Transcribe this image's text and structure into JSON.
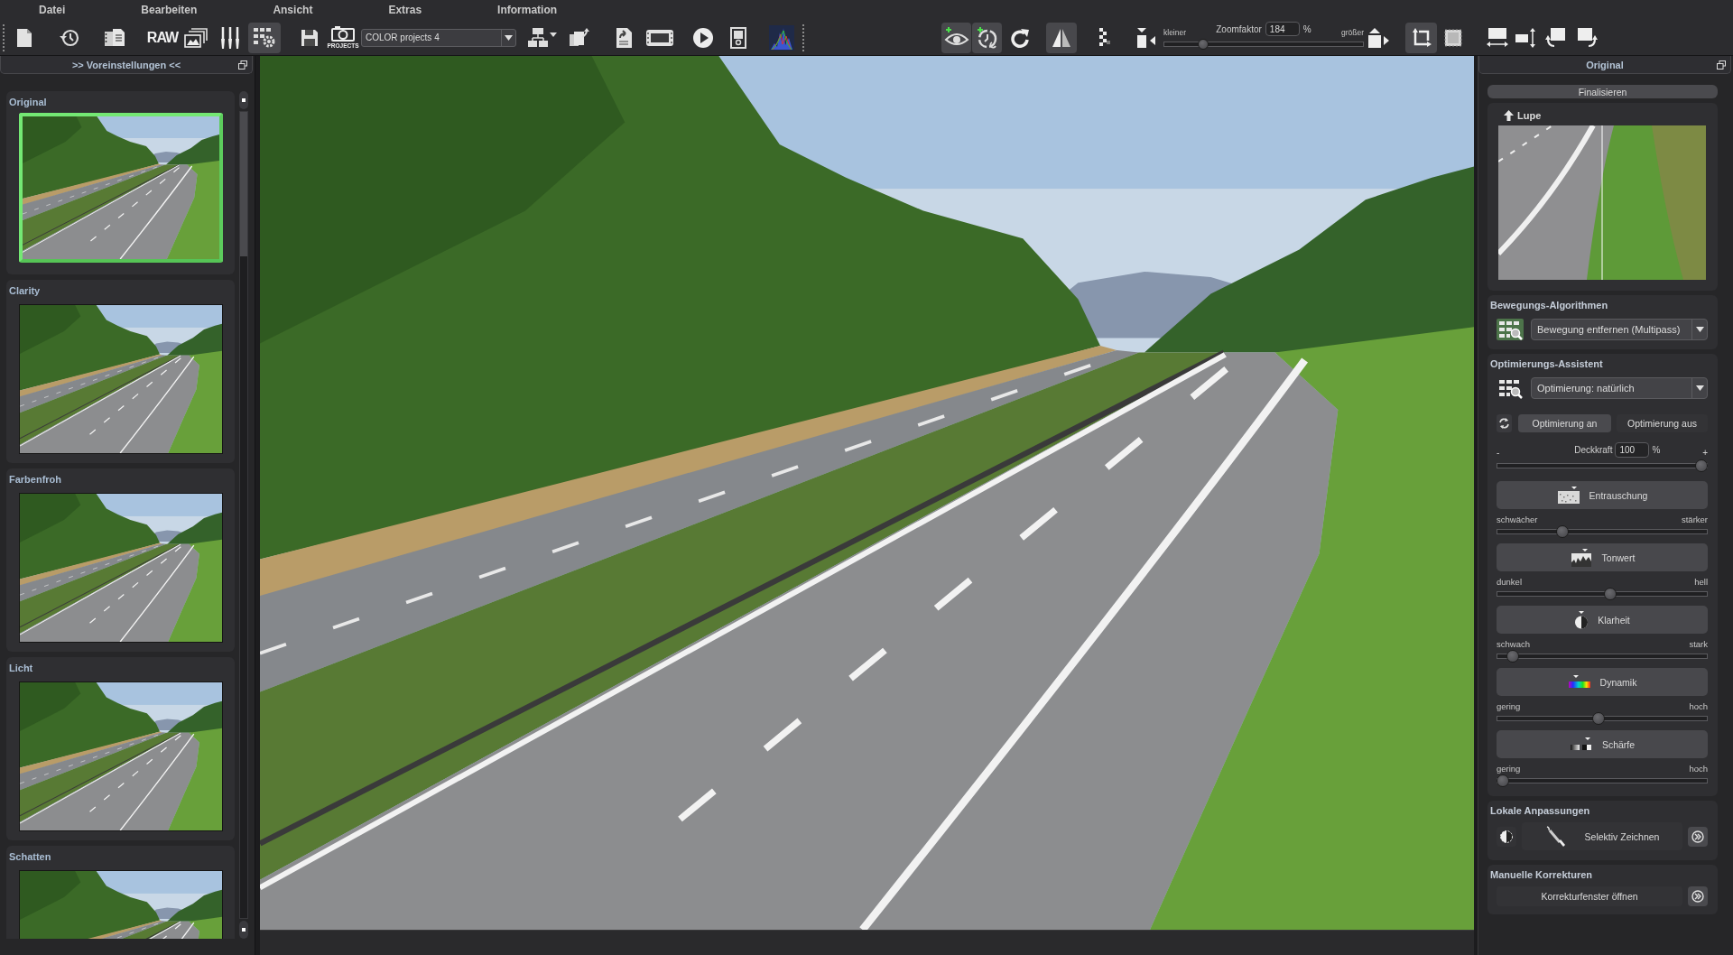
{
  "menu": [
    "Datei",
    "Bearbeiten",
    "Ansicht",
    "Extras",
    "Information"
  ],
  "toolbar": {
    "file_tools": [
      {
        "active": false
      },
      {
        "active": false
      },
      {
        "active": false
      },
      {
        "label": "RAW",
        "active": false
      },
      {
        "active": false
      },
      {
        "active": false
      },
      {
        "active": true
      }
    ],
    "project_tools": [
      {
        "active": false
      },
      {
        "label": "PROJECTS",
        "active": false
      }
    ],
    "project_select": {
      "value": "COLOR projects 4"
    },
    "output_tools": [
      {
        "active": false
      },
      {
        "active": false
      },
      {
        "active": false
      },
      {
        "active": false
      },
      {
        "active": false
      },
      {
        "active": false
      },
      {
        "active": false
      }
    ],
    "view_tools": [
      {
        "active": true
      },
      {
        "active": true
      },
      {
        "active": false
      },
      {
        "active": true
      },
      {
        "active": false
      }
    ],
    "zoom": {
      "smaller": "kleiner",
      "label": "Zoomfaktor",
      "value": "184",
      "unit": "%",
      "larger": "größer",
      "level": 0.18
    },
    "frame_tools": [
      {
        "active": true
      },
      {
        "active": false
      },
      {
        "active": false
      },
      {
        "active": false
      },
      {
        "active": false
      },
      {
        "active": false
      }
    ]
  },
  "presets": {
    "title": ">> Voreinstellungen <<",
    "items": [
      {
        "label": "Original",
        "selected": true
      },
      {
        "label": "Clarity",
        "selected": false
      },
      {
        "label": "Farbenfroh",
        "selected": false
      },
      {
        "label": "Licht",
        "selected": false
      },
      {
        "label": "Schatten",
        "selected": false
      }
    ]
  },
  "panel": {
    "title": "Original",
    "finalize": "Finalisieren",
    "loupe": {
      "label": "Lupe"
    },
    "motion": {
      "title": "Bewegungs-Algorithmen",
      "select": "Bewegung entfernen (Multipass)"
    },
    "optimizer": {
      "title": "Optimierungs-Assistent",
      "select": "Optimierung: natürlich",
      "modes": [
        {
          "label": "Optimierung an",
          "selected": true
        },
        {
          "label": "Optimierung aus",
          "selected": false
        }
      ],
      "opacity": {
        "minus": "-",
        "label": "Deckkraft",
        "value": "100",
        "unit": "%",
        "plus": "+",
        "level": 1
      },
      "adjustments": [
        {
          "label": "Entrauschung",
          "low": "schwächer",
          "high": "stärker",
          "level": 0.3
        },
        {
          "label": "Tonwert",
          "low": "dunkel",
          "high": "hell",
          "level": 0.54
        },
        {
          "label": "Klarheit",
          "low": "schwach",
          "high": "stark",
          "level": 0.05
        },
        {
          "label": "Dynamik",
          "low": "gering",
          "high": "hoch",
          "level": 0.48
        },
        {
          "label": "Schärfe",
          "low": "gering",
          "high": "hoch",
          "level": 0
        }
      ]
    },
    "local": {
      "title": "Lokale Anpassungen",
      "button": "Selektiv Zeichnen"
    },
    "manual": {
      "title": "Manuelle Korrekturen",
      "button": "Korrekturfenster öffnen"
    }
  }
}
